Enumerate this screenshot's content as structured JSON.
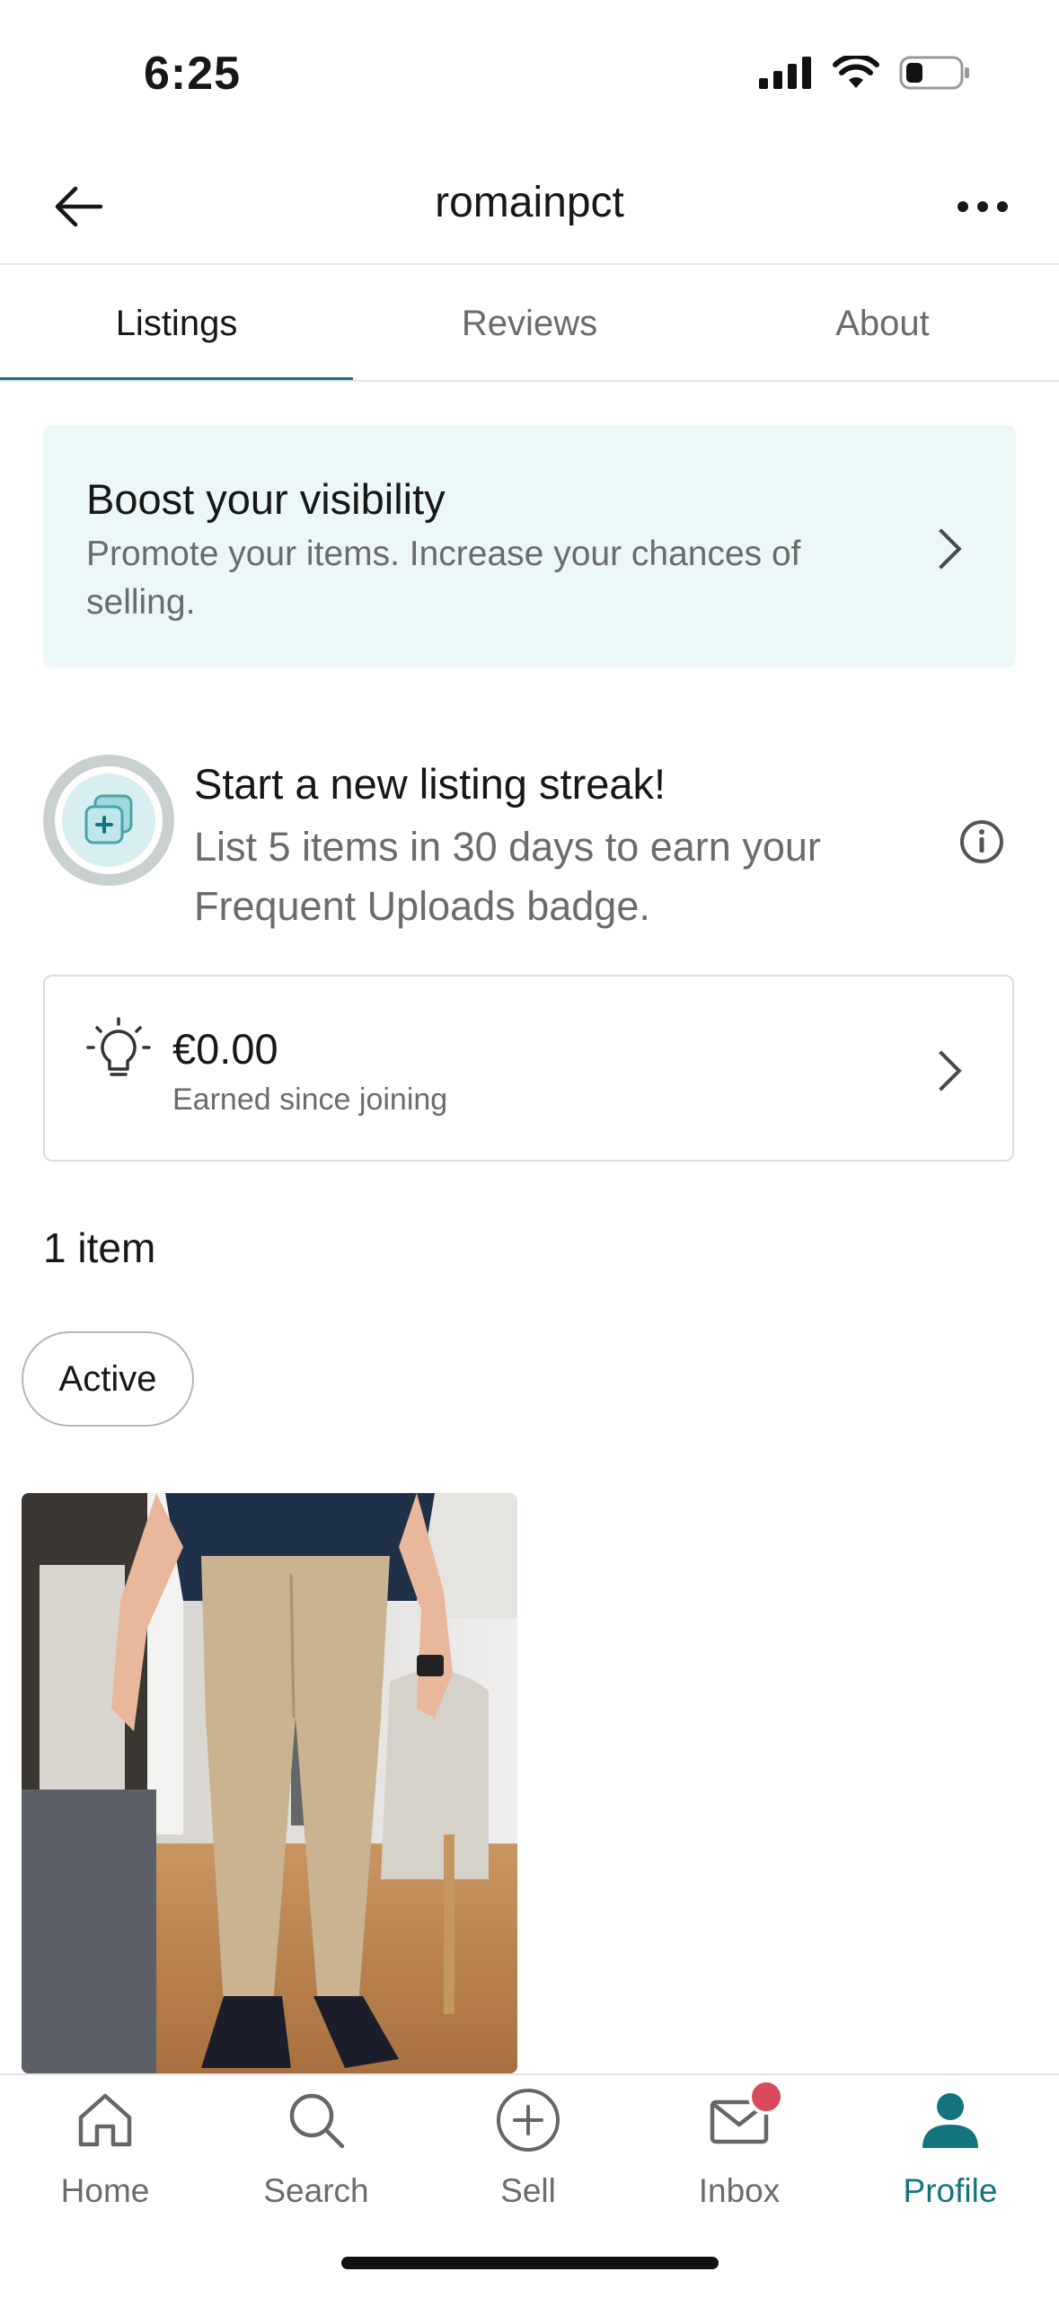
{
  "status_bar": {
    "time": "6:25"
  },
  "header": {
    "title": "romainpct"
  },
  "tabs": [
    {
      "label": "Listings",
      "active": true
    },
    {
      "label": "Reviews",
      "active": false
    },
    {
      "label": "About",
      "active": false
    }
  ],
  "boost": {
    "title": "Boost your visibility",
    "subtitle": "Promote your items. Increase your chances of selling."
  },
  "streak": {
    "title": "Start a new listing streak!",
    "subtitle": "List 5 items in 30 days to earn your Frequent Uploads badge."
  },
  "earnings": {
    "amount": "€0.00",
    "label": "Earned since joining"
  },
  "items": {
    "count_label": "1 item",
    "filter_chip": "Active"
  },
  "bottom_nav": [
    {
      "label": "Home",
      "icon": "home-icon",
      "active": false
    },
    {
      "label": "Search",
      "icon": "search-icon",
      "active": false
    },
    {
      "label": "Sell",
      "icon": "plus-circle-icon",
      "active": false
    },
    {
      "label": "Inbox",
      "icon": "mail-icon",
      "active": false,
      "badge": true
    },
    {
      "label": "Profile",
      "icon": "person-icon",
      "active": true
    }
  ],
  "colors": {
    "accent": "#13747d",
    "boost_bg": "#ecf7f7",
    "badge": "#d94a5c"
  }
}
